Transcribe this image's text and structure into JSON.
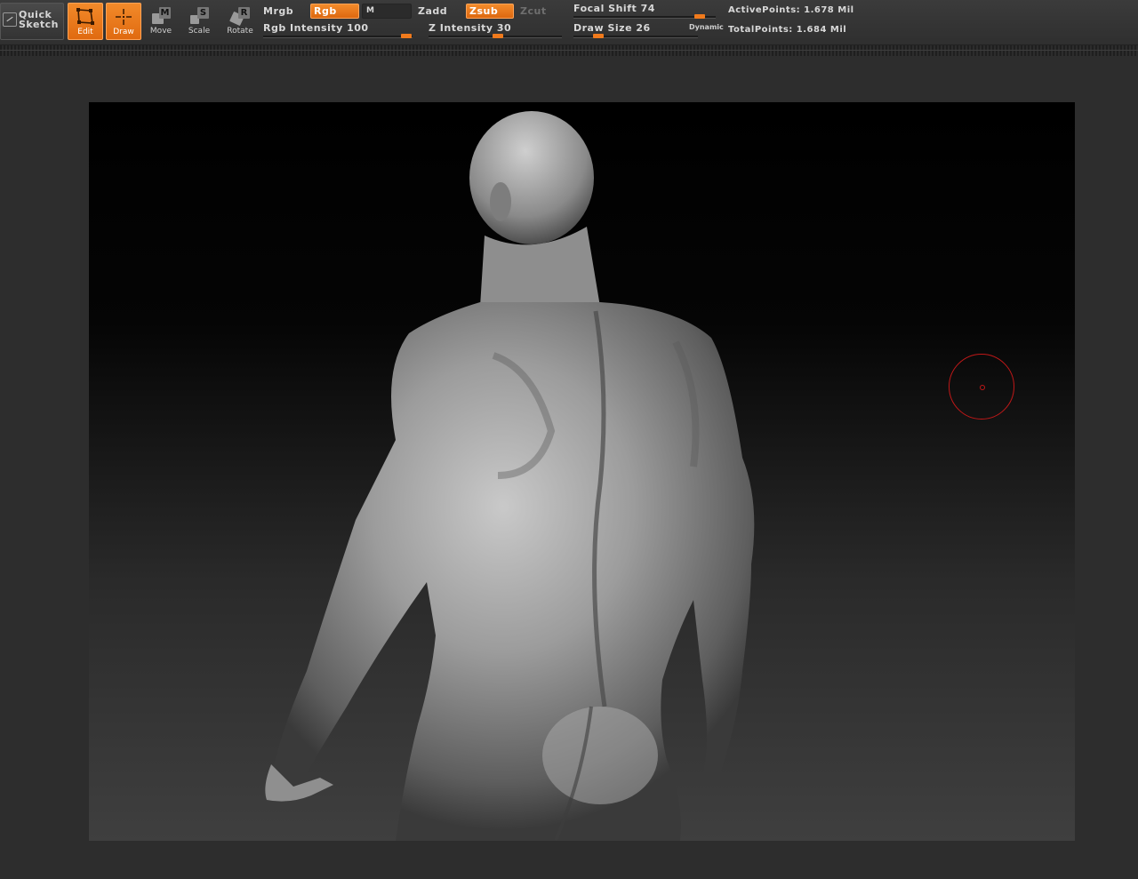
{
  "toolbar": {
    "quick_sketch": [
      "Quick",
      "Sketch"
    ],
    "edit_label": "Edit",
    "draw_label": "Draw",
    "move_label": "Move",
    "move_key": "M",
    "scale_label": "Scale",
    "scale_key": "S",
    "rotate_label": "Rotate",
    "rotate_key": "R",
    "mrgb_label": "Mrgb",
    "rgb_label": "Rgb",
    "m_label": "M",
    "zadd_label": "Zadd",
    "zsub_label": "Zsub",
    "zcut_label": "Zcut",
    "rgb_intensity_label": "Rgb Intensity 100",
    "rgb_intensity_value": 100,
    "z_intensity_label": "Z Intensity 30",
    "z_intensity_value": 30,
    "focal_shift_label": "Focal Shift 74",
    "focal_shift_value": 74,
    "draw_size_label": "Draw Size 26",
    "draw_size_value": 26,
    "dynamic_label": "Dynamic",
    "active_points": "ActivePoints: 1.678 Mil",
    "total_points": "TotalPoints: 1.684 Mil"
  },
  "active_modes": [
    "Edit",
    "Draw",
    "Rgb",
    "Zsub"
  ],
  "colors": {
    "accent": "#e8751a",
    "background": "#2d2d2d",
    "brush_cursor": "#c01818",
    "model": "#9a9a9a"
  },
  "icons": [
    "sketch-icon",
    "edit-icon",
    "draw-crosshair-icon",
    "move-icon",
    "scale-icon",
    "rotate-icon",
    "brush-cursor-icon"
  ]
}
